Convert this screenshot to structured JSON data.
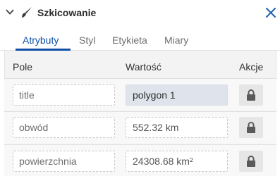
{
  "header": {
    "title": "Szkicowanie",
    "collapse_icon": "chevron-down-icon",
    "tool_icon": "brush-icon",
    "close_icon": "close-icon"
  },
  "tabs": [
    {
      "label": "Atrybuty",
      "active": true
    },
    {
      "label": "Styl",
      "active": false
    },
    {
      "label": "Etykieta",
      "active": false
    },
    {
      "label": "Miary",
      "active": false
    }
  ],
  "table": {
    "columns": {
      "field": "Pole",
      "value": "Wartość",
      "actions": "Akcje"
    },
    "rows": [
      {
        "field": "title",
        "value": "polygon 1",
        "lock_icon": "lock-icon"
      },
      {
        "field": "obwód",
        "value": "552.32 km",
        "lock_icon": "lock-icon"
      },
      {
        "field": "powierzchnia",
        "value": "24308.68 km²",
        "lock_icon": "lock-icon"
      }
    ]
  },
  "colors": {
    "accent": "#0f4fa6",
    "close": "#1d5fb0",
    "panel_bg": "#f3f3f3",
    "filled_value_bg": "#dfe4ec"
  }
}
